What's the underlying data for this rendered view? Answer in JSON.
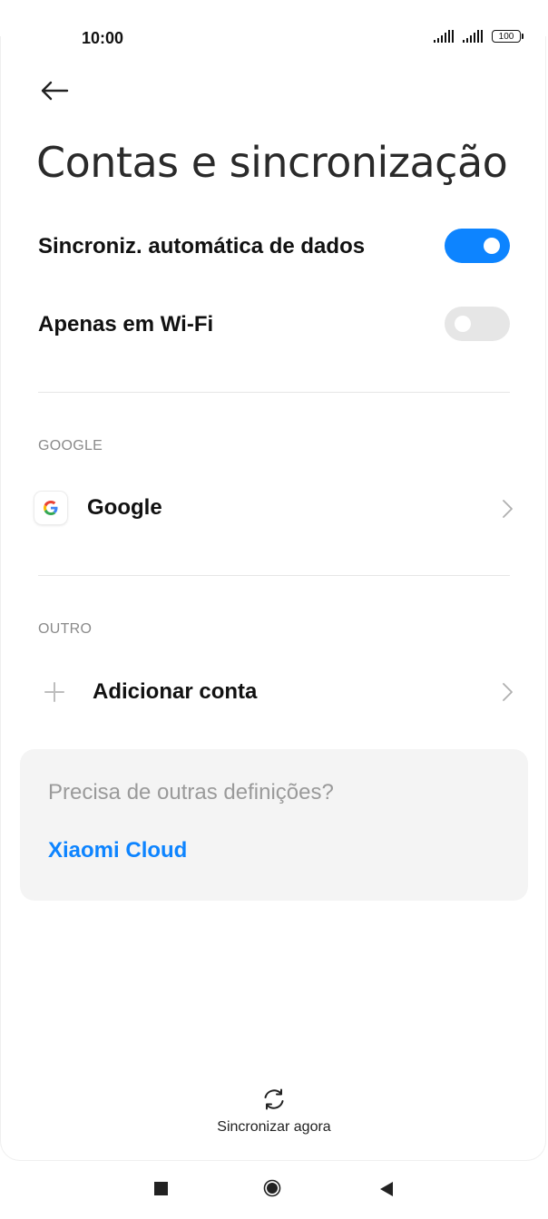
{
  "status_bar": {
    "time": "10:00",
    "battery": "100"
  },
  "header": {
    "title": "Contas e sincronização"
  },
  "settings": {
    "auto_sync": {
      "label": "Sincroniz. automática de dados",
      "enabled": true
    },
    "wifi_only": {
      "label": "Apenas em Wi-Fi",
      "enabled": false
    }
  },
  "sections": {
    "google": {
      "header": "GOOGLE",
      "account_label": "Google"
    },
    "other": {
      "header": "OUTRO",
      "add_account_label": "Adicionar conta"
    }
  },
  "card": {
    "question": "Precisa de outras definições?",
    "link": "Xiaomi Cloud"
  },
  "footer": {
    "sync_now_label": "Sincronizar agora"
  },
  "colors": {
    "accent": "#0d84ff",
    "toggle_off": "#e6e6e6",
    "card_bg": "#f4f4f4"
  },
  "icons": [
    "back-arrow-icon",
    "signal-icon",
    "battery-icon",
    "google-logo-icon",
    "plus-icon",
    "chevron-right-icon",
    "sync-icon",
    "recent-apps-icon",
    "home-icon",
    "back-triangle-icon"
  ]
}
